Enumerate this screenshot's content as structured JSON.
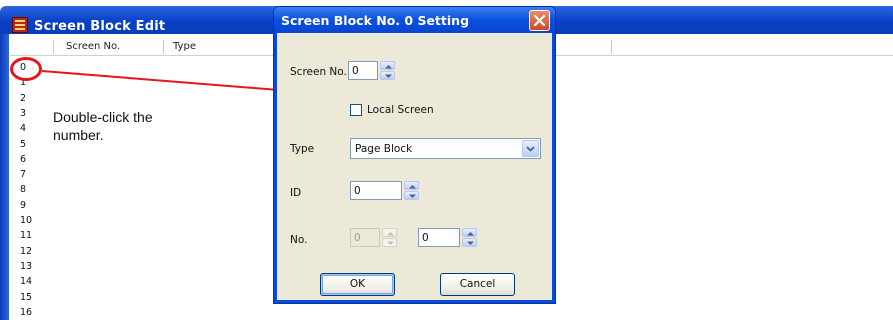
{
  "background_window": {
    "title": "Screen Block Edit",
    "columns": [
      "Screen No.",
      "Type"
    ],
    "row_numbers": [
      "0",
      "1",
      "2",
      "3",
      "4",
      "5",
      "6",
      "7",
      "8",
      "9",
      "10",
      "11",
      "12",
      "13",
      "14",
      "15",
      "16"
    ]
  },
  "annotation": {
    "note_line1": "Double-click the",
    "note_line2": "number."
  },
  "dialog": {
    "title": "Screen Block No. 0 Setting",
    "screen_no_label": "Screen No.",
    "screen_no_value": "0",
    "local_screen_label": "Local Screen",
    "local_screen_checked": false,
    "type_label": "Type",
    "type_value": "Page Block",
    "id_label": "ID",
    "id_value": "0",
    "no_label": "No.",
    "no_value_1": "0",
    "no_value_2": "0",
    "ok_label": "OK",
    "cancel_label": "Cancel"
  },
  "colors": {
    "titlebar": "#0a50e0",
    "dialog_bg": "#ece9d8",
    "annotation_red": "#e8151b",
    "close_button": "#cf4b25"
  },
  "icons": {
    "app_icon": "screen-block-app-icon",
    "close": "close-x-icon",
    "spin_up": "triangle-up-icon",
    "spin_down": "triangle-down-icon",
    "dropdown": "chevron-down-icon"
  }
}
